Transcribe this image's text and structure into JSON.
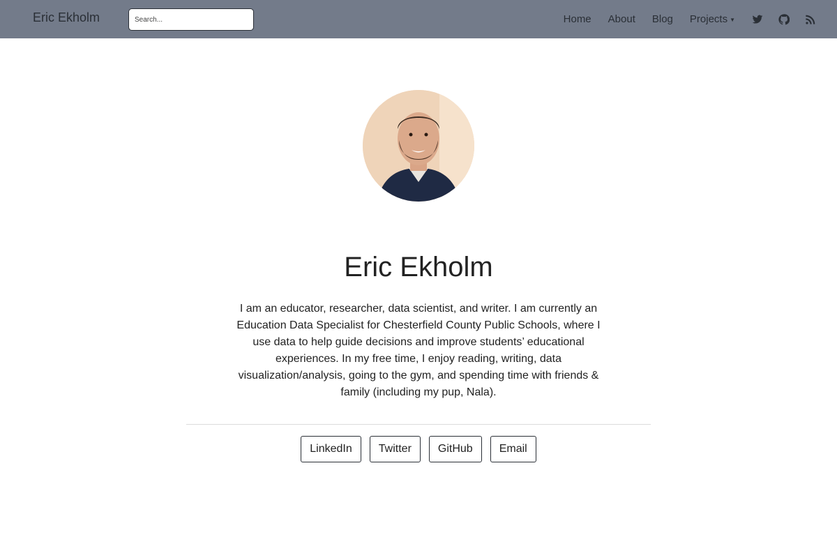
{
  "navbar": {
    "brand": "Eric Ekholm",
    "search_placeholder": "Search...",
    "links": [
      {
        "label": "Home"
      },
      {
        "label": "About"
      },
      {
        "label": "Blog"
      },
      {
        "label": "Projects"
      }
    ],
    "icons": [
      "twitter-icon",
      "github-icon",
      "rss-icon"
    ],
    "background_color": "#737b8a"
  },
  "profile": {
    "name": "Eric Ekholm",
    "bio": "I am an educator, researcher, data scientist, and writer. I am currently an Education Data Specialist for Chesterfield County Public Schools, where I use data to help guide decisions and improve students’ educational experiences. In my free time, I enjoy reading, writing, data visualization/analysis, going to the gym, and spending time with friends & family (including my pup, Nala).",
    "buttons": [
      {
        "label": "LinkedIn"
      },
      {
        "label": "Twitter"
      },
      {
        "label": "GitHub"
      },
      {
        "label": "Email"
      }
    ]
  }
}
